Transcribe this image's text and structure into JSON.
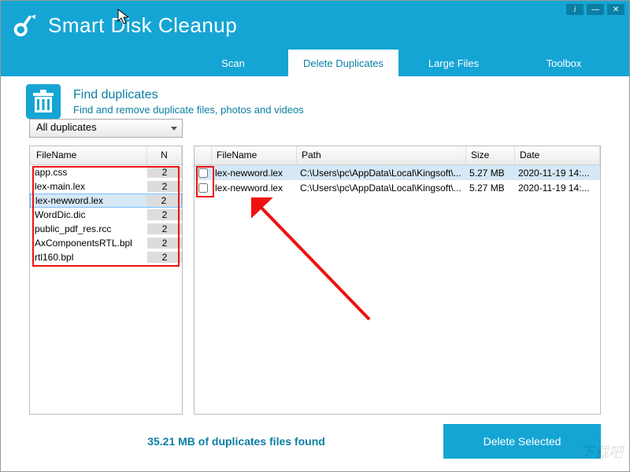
{
  "app": {
    "title": "Smart Disk Cleanup"
  },
  "tabs": {
    "scan": "Scan",
    "duplicates": "Delete Duplicates",
    "large": "Large Files",
    "toolbox": "Toolbox"
  },
  "section": {
    "title": "Find duplicates",
    "subtitle": "Find and remove duplicate files, photos and videos"
  },
  "filter": {
    "selected": "All duplicates"
  },
  "leftHeaders": {
    "name": "FileName",
    "n": "N"
  },
  "leftRows": [
    {
      "name": "app.css",
      "n": "2"
    },
    {
      "name": "lex-main.lex",
      "n": "2"
    },
    {
      "name": "lex-newword.lex",
      "n": "2"
    },
    {
      "name": "WordDic.dic",
      "n": "2"
    },
    {
      "name": "public_pdf_res.rcc",
      "n": "2"
    },
    {
      "name": "AxComponentsRTL.bpl",
      "n": "2"
    },
    {
      "name": "rtl160.bpl",
      "n": "2"
    }
  ],
  "rightHeaders": {
    "name": "FileName",
    "path": "Path",
    "size": "Size",
    "date": "Date"
  },
  "rightRows": [
    {
      "name": "lex-newword.lex",
      "path": "C:\\Users\\pc\\AppData\\Local\\Kingsoft\\...",
      "size": "5.27 MB",
      "date": "2020-11-19 14:..."
    },
    {
      "name": "lex-newword.lex",
      "path": "C:\\Users\\pc\\AppData\\Local\\Kingsoft\\...",
      "size": "5.27 MB",
      "date": "2020-11-19 14:..."
    }
  ],
  "footer": {
    "status": "35.21 MB of duplicates files found",
    "deleteLabel": "Delete Selected"
  },
  "watermark": "下载吧"
}
